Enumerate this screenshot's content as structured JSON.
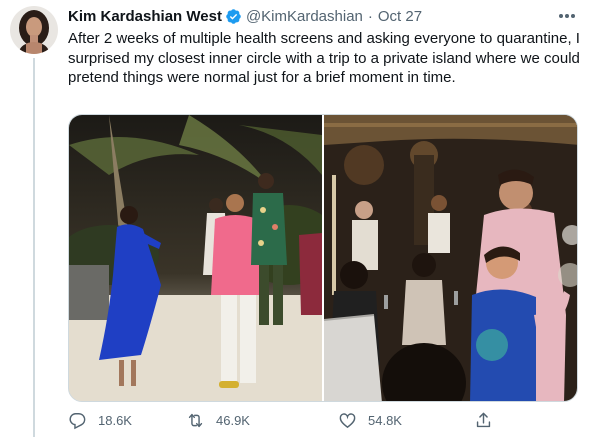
{
  "tweet": {
    "display_name": "Kim Kardashian West",
    "handle": "@KimKardashian",
    "separator": "·",
    "date": "Oct 27",
    "verified": true,
    "text": "After 2 weeks of multiple health screens and asking everyone to quarantine, I surprised my closest inner circle with a trip to a private island where we could pretend things were normal just for a brief moment in time.",
    "more_icon": "more-horizontal-icon",
    "media": [
      {
        "name": "photo-party-left",
        "description": "night beach party photo"
      },
      {
        "name": "photo-party-right",
        "description": "dinner table party photo"
      }
    ],
    "actions": {
      "reply": {
        "icon": "reply-icon",
        "count": "18.6K"
      },
      "retweet": {
        "icon": "retweet-icon",
        "count": "46.9K"
      },
      "like": {
        "icon": "heart-icon",
        "count": "54.8K"
      },
      "share": {
        "icon": "share-icon"
      }
    }
  },
  "colors": {
    "text": "#0f1419",
    "secondary": "#536471",
    "verified": "#1d9bf0",
    "border": "#cfd9de"
  }
}
